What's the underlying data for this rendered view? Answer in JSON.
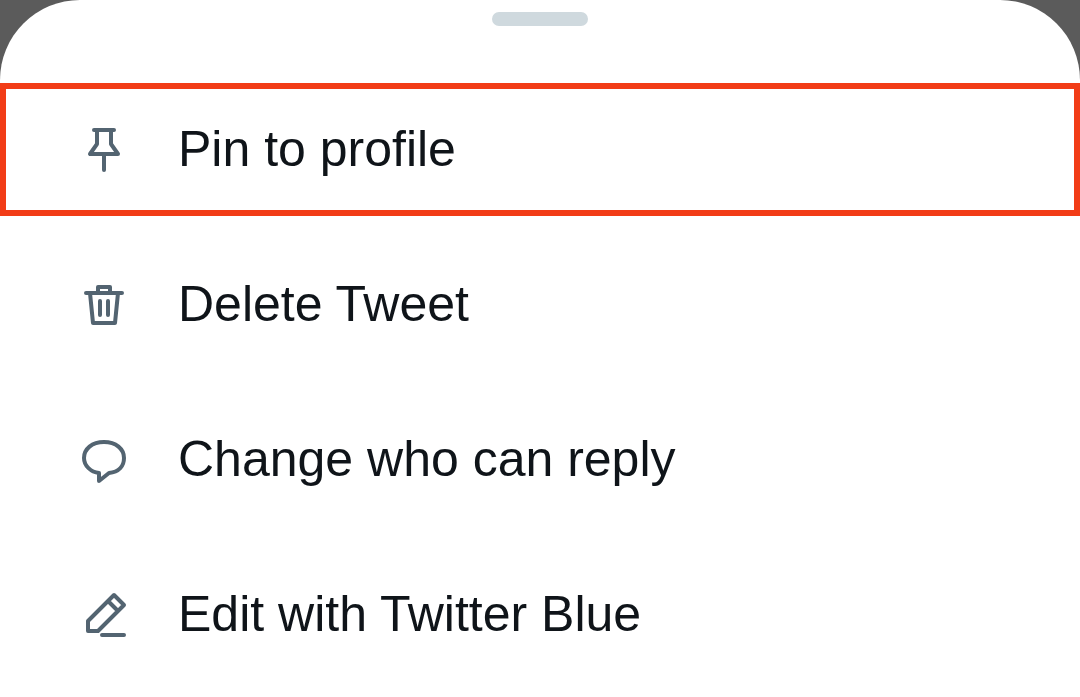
{
  "menu_items": [
    {
      "label": "Pin to profile",
      "highlighted": true
    },
    {
      "label": "Delete Tweet",
      "highlighted": false
    },
    {
      "label": "Change who can reply",
      "highlighted": false
    },
    {
      "label": "Edit with Twitter Blue",
      "highlighted": false
    }
  ]
}
